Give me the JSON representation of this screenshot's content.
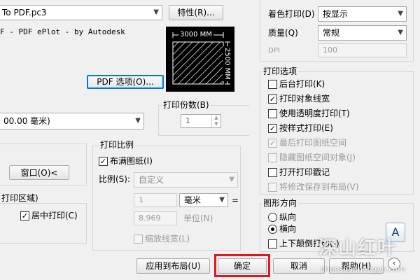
{
  "plotter": {
    "name": "To PDF.pc3",
    "description": "F - PDF ePlot - by Autodesk",
    "properties_button": "特性(R)...",
    "pdf_options_button": "PDF 选项(O)...",
    "preview_width": "3000 MM",
    "preview_height": "2500 MM"
  },
  "paper_size": {
    "value": "00.00 毫米)"
  },
  "copies": {
    "label": "打印份数(B)",
    "value": "1"
  },
  "plot_area": {
    "window_button": "窗口(O)<"
  },
  "plot_offset": {
    "title": "打印区域)",
    "center_plot": "居中打印(C)"
  },
  "plot_scale": {
    "title": "打印比例",
    "fit_to_paper": "布满图纸(I)",
    "scale_label": "比例(S):",
    "scale_value": "自定义",
    "value1": "1",
    "unit": "毫米",
    "equals": "=",
    "value2": "8.969",
    "unit_label": "单位(N)",
    "scale_lineweights": "缩放线宽(L)"
  },
  "shaded": {
    "color_plot_label": "着色打印(D)",
    "color_plot_value": "按显示",
    "quality_label": "质量(Q)",
    "quality_value": "常规",
    "dpi_label": "DPI",
    "dpi_value": "100"
  },
  "plot_options": {
    "title": "打印选项",
    "items": [
      {
        "label": "后台打印(K)",
        "checked": false,
        "enabled": true
      },
      {
        "label": "打印对象线宽",
        "checked": true,
        "enabled": true
      },
      {
        "label": "使用透明度打印(T)",
        "checked": false,
        "enabled": true
      },
      {
        "label": "按样式打印(E)",
        "checked": true,
        "enabled": true
      },
      {
        "label": "最后打印图纸空间",
        "checked": true,
        "enabled": false
      },
      {
        "label": "隐藏图纸空间对象(J)",
        "checked": false,
        "enabled": false
      },
      {
        "label": "打开打印戳记",
        "checked": false,
        "enabled": true
      },
      {
        "label": "将修改保存到布局(V)",
        "checked": false,
        "enabled": false
      }
    ]
  },
  "orientation": {
    "title": "图形方向",
    "portrait": "纵向",
    "landscape": "横向",
    "upside_down": "上下颠倒打印(-)",
    "icon_letter": "A"
  },
  "footer": {
    "apply_button": "应用到布局(U)",
    "ok_button": "确定",
    "cancel_button": "取消",
    "help_button": "帮助(H)"
  },
  "watermark": {
    "logo_text": "深山红叶",
    "url": "shenshanhongye.com"
  },
  "colors": {
    "highlight": "#e0171c",
    "accent": "#0050a0"
  }
}
